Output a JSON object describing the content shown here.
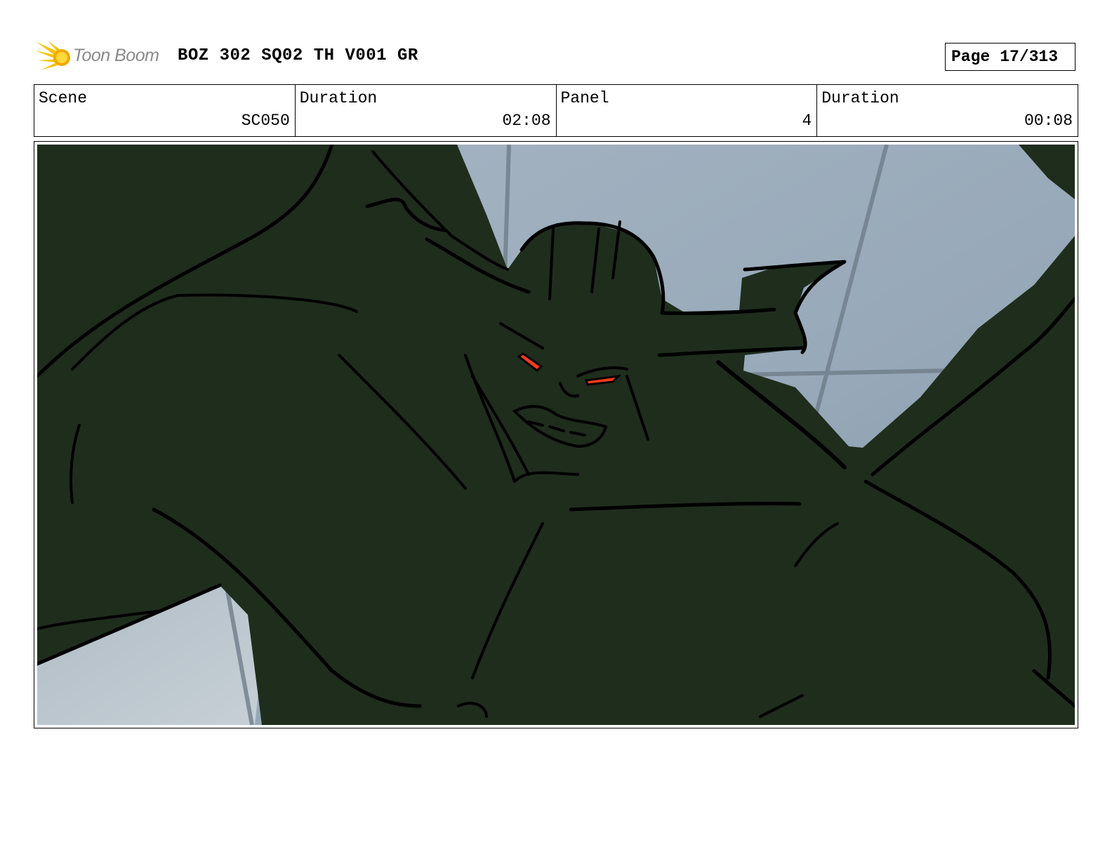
{
  "header": {
    "logo_text": "Toon Boom",
    "title": "BOZ 302 SQ02 TH V001 GR",
    "page_label": "Page",
    "page_number": "17/313"
  },
  "info": {
    "scene_label": "Scene",
    "scene_value": "SC050",
    "scene_duration_label": "Duration",
    "scene_duration_value": "02:08",
    "panel_label": "Panel",
    "panel_value": "4",
    "panel_duration_label": "Duration",
    "panel_duration_value": "00:08"
  },
  "colors": {
    "creature": "#1f2d1d",
    "sky": "#97a8b8",
    "eyes": "#ff3b1a",
    "logo_yellow": "#f5c400"
  },
  "icons": [
    "toon-boom-logo-icon"
  ]
}
